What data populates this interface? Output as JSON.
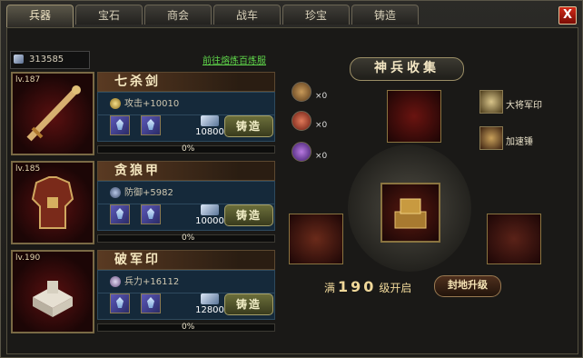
{
  "tabs": [
    {
      "label": "兵器",
      "active": true
    },
    {
      "label": "宝石",
      "active": false
    },
    {
      "label": "商会",
      "active": false
    },
    {
      "label": "战车",
      "active": false
    },
    {
      "label": "珍宝",
      "active": false
    },
    {
      "label": "铸造",
      "active": false
    }
  ],
  "close_label": "X",
  "resource": {
    "icon": "silver-ore-icon",
    "value": "313585"
  },
  "goto_link": "前往熔炼百炼服",
  "items": [
    {
      "level": "lv.187",
      "name": "七杀剑",
      "stat": "攻击+10010",
      "stat_icon": "sword-medal-icon",
      "cost": "10800",
      "forge_label": "铸造",
      "progress": "0%",
      "progress_value": 0
    },
    {
      "level": "lv.185",
      "name": "贪狼甲",
      "stat": "防御+5982",
      "stat_icon": "shield-medal-icon",
      "cost": "10000",
      "forge_label": "铸造",
      "progress": "0%",
      "progress_value": 0
    },
    {
      "level": "lv.190",
      "name": "破军印",
      "stat": "兵力+16112",
      "stat_icon": "troop-medal-icon",
      "cost": "12800",
      "forge_label": "铸造",
      "progress": "0%",
      "progress_value": 0
    }
  ],
  "collection": {
    "title": "神兵收集",
    "hammers": [
      {
        "icon": "bronze-hammer-icon",
        "count": "×0"
      },
      {
        "icon": "red-hammer-icon",
        "count": "×0"
      },
      {
        "icon": "purple-hammer-icon",
        "count": "×0"
      }
    ],
    "seal_label": "大将军印",
    "speed_label": "加速锤",
    "footer_prefix": "满",
    "footer_level": "190",
    "footer_suffix": "级开启",
    "upgrade_button": "封地升级"
  },
  "colors": {
    "accent_green": "#5fd64a",
    "panel_blue": "#15293a",
    "close_red": "#d22a18"
  }
}
